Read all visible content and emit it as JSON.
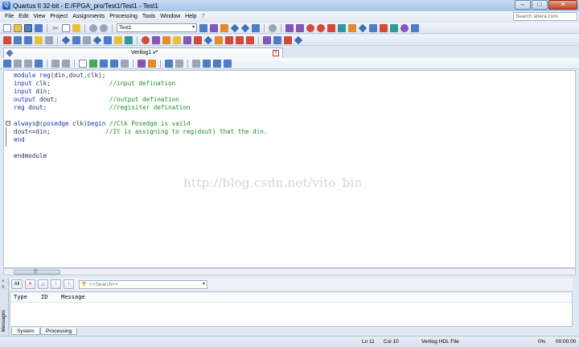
{
  "window": {
    "title": "Quartus II 32-bit - E:/FPGA_pro/Test1/Test1 - Test1",
    "logo_letter": "Q",
    "controls": {
      "minimize": "–",
      "maximize": "□",
      "close": "✕"
    }
  },
  "menu": {
    "items": [
      "File",
      "Edit",
      "View",
      "Project",
      "Assignments",
      "Processing",
      "Tools",
      "Window",
      "Help"
    ],
    "help_icon": "?",
    "search_placeholder": "Search altera.com"
  },
  "toolbar": {
    "entity_value": "Test1",
    "dropdown_arrow": "▾"
  },
  "document": {
    "tab_label": "Verilog1.v*",
    "close_glyph": "×"
  },
  "editor": {
    "lines": [
      {
        "parts": [
          [
            "kw",
            "module reg"
          ],
          [
            "txt",
            "(din,dout,clk);"
          ]
        ]
      },
      {
        "parts": [
          [
            "kw",
            "input "
          ],
          [
            "txt",
            "clk;                "
          ],
          [
            "cmt",
            "//input defination"
          ]
        ]
      },
      {
        "parts": [
          [
            "kw",
            "input "
          ],
          [
            "txt",
            "din;"
          ]
        ]
      },
      {
        "parts": [
          [
            "kw",
            "output "
          ],
          [
            "txt",
            "dout;              "
          ],
          [
            "cmt",
            "//output defination"
          ]
        ]
      },
      {
        "parts": [
          [
            "kw",
            "reg "
          ],
          [
            "txt",
            "dout;                 "
          ],
          [
            "cmt",
            "//regisiter defination"
          ]
        ]
      },
      {
        "parts": []
      },
      {
        "fold": "−",
        "parts": [
          [
            "kw",
            "always"
          ],
          [
            "txt",
            "@("
          ],
          [
            "kw",
            "posedge "
          ],
          [
            "txt",
            "clk)"
          ],
          [
            "kw",
            "begin "
          ],
          [
            "cmt",
            "//Clk Posedge is vaild"
          ]
        ]
      },
      {
        "parts": [
          [
            "txt",
            "dout<=din;               "
          ],
          [
            "cmt",
            "//It is assigning to reg(dout) that the din."
          ]
        ]
      },
      {
        "parts": [
          [
            "kw",
            "end"
          ]
        ]
      },
      {
        "parts": []
      },
      {
        "parts": [
          [
            "txt",
            "endmodule"
          ]
        ]
      }
    ],
    "watermark": "http://blog.csdn.net/vito_bin",
    "scroll_grip": "|||"
  },
  "messages": {
    "side_label": "Messages",
    "side_ctrls": "× ≡",
    "filters": {
      "all": "All",
      "error": "✕",
      "critical": "△",
      "warning": "!",
      "info": "i"
    },
    "search_placeholder": "<<Search>>",
    "columns": [
      "Type",
      "ID",
      "Message"
    ],
    "tabs": [
      "System",
      "Processing"
    ]
  },
  "status": {
    "line": "Ln 11",
    "col": "Col 10",
    "file_type": "Verilog HDL File",
    "progress": "0%",
    "time": "00:00:00"
  }
}
